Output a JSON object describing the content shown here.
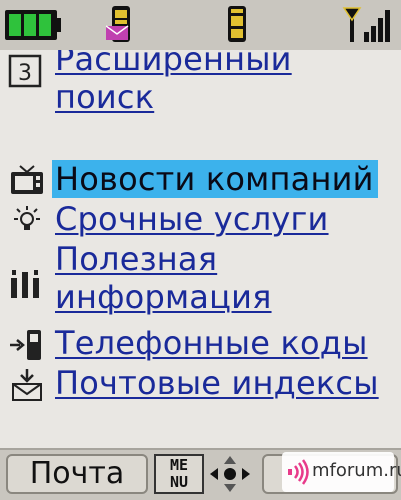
{
  "status_bar": {
    "icons": [
      "battery-icon",
      "sms-icon",
      "mms-icon",
      "signal-icon"
    ]
  },
  "menu": {
    "items": [
      {
        "number": "3",
        "lines": [
          "Расширенный",
          "поиск"
        ],
        "icon": "number-3-icon"
      },
      {
        "lines": [
          "Новости компаний"
        ],
        "icon": "tv-icon",
        "selected": true
      },
      {
        "lines": [
          "Срочные услуги"
        ],
        "icon": "lamp-icon"
      },
      {
        "lines": [
          "Полезная",
          "информация"
        ],
        "icon": "info-bars-icon"
      },
      {
        "lines": [
          "Телефонные коды"
        ],
        "icon": "phone-arrow-icon"
      },
      {
        "lines": [
          "Почтовые индексы"
        ],
        "icon": "mail-download-icon"
      }
    ]
  },
  "softkeys": {
    "left": "Почта",
    "menu_glyph": [
      "ME",
      "NU"
    ],
    "right": ""
  },
  "watermark": {
    "text": "mforum.ru"
  },
  "colors": {
    "link": "#1a2a9a",
    "selection": "#3cb2ec",
    "background": "#e9e7e3"
  }
}
